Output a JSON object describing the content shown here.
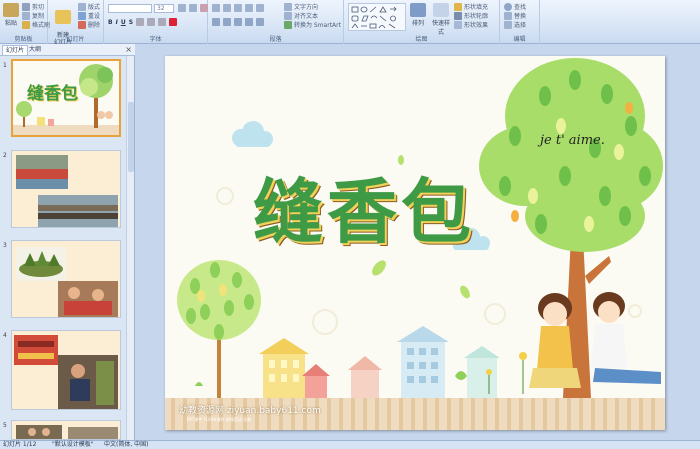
{
  "ribbon": {
    "clipboard": {
      "paste": "粘贴",
      "cut": "剪切",
      "copy": "复制",
      "format_painter": "格式刷",
      "label": "剪贴板"
    },
    "slides": {
      "new_slide": "新建\n幻灯片",
      "layout": "版式",
      "reset": "重设",
      "delete": "删除",
      "label": "幻灯片"
    },
    "font": {
      "font_value": "",
      "size_value": "32",
      "label": "字体"
    },
    "paragraph": {
      "text_direction": "文字方向",
      "align_text": "对齐文本",
      "smartart": "转换为 SmartArt",
      "label": "段落"
    },
    "drawing": {
      "arrange": "排列",
      "quick_styles": "快速样式",
      "shape_fill": "形状填充",
      "shape_outline": "形状轮廓",
      "shape_effects": "形状效果",
      "label": "绘图"
    },
    "editing": {
      "find": "查找",
      "replace": "替换",
      "select": "选择",
      "label": "编辑"
    }
  },
  "panel": {
    "tab_slides": "幻灯片",
    "tab_outline": "大纲",
    "close": "×",
    "thumbs": [
      {
        "num": "1",
        "title": "缝香包"
      },
      {
        "num": "2"
      },
      {
        "num": "3"
      },
      {
        "num": "4"
      },
      {
        "num": "5"
      }
    ]
  },
  "slide": {
    "title": "缝香包",
    "script_text": "je t' aime.",
    "watermark": "幼教资源网 ziyuan.baby611.com",
    "watermark_sub": "PPT课件 FLASH课件 视频活动 试卷"
  },
  "status": {
    "slide_count": "幻灯片 1/12",
    "theme": "\"默认设计模板\"",
    "language": "中文(简体, 中国)"
  },
  "colors": {
    "title_green": "#3e9a45",
    "title_outline": "#f0d25a",
    "selected_thumb_border": "#e8a23a",
    "ribbon_bg": "#dce8f7"
  }
}
